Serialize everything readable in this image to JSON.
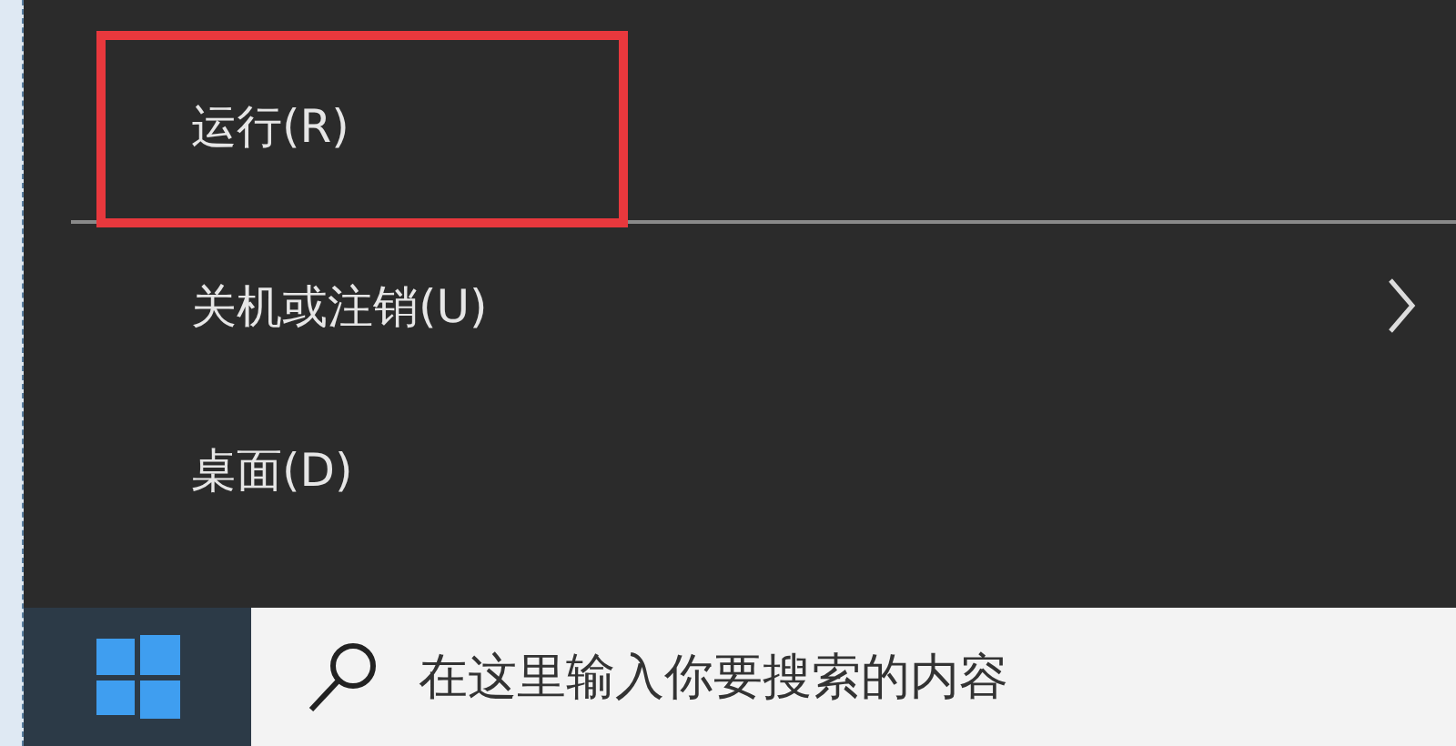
{
  "menu": {
    "items": [
      {
        "kind": "item",
        "label": "运行(R)",
        "highlighted": true,
        "submenu": false
      },
      {
        "kind": "separator"
      },
      {
        "kind": "item",
        "label": "关机或注销(U)",
        "highlighted": false,
        "submenu": true
      },
      {
        "kind": "item",
        "label": "桌面(D)",
        "highlighted": false,
        "submenu": false
      }
    ]
  },
  "taskbar": {
    "search": {
      "placeholder": "在这里输入你要搜索的内容"
    }
  }
}
